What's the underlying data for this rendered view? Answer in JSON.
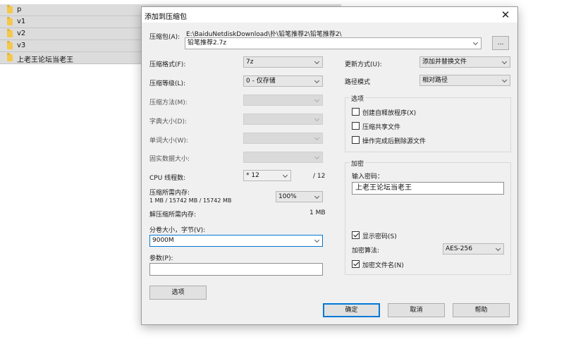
{
  "explorer": {
    "rows": [
      {
        "name": "p"
      },
      {
        "name": "v1"
      },
      {
        "name": "v2"
      },
      {
        "name": "v3"
      },
      {
        "name": "上老王论坛当老王"
      }
    ]
  },
  "dialog": {
    "title": "添加到压缩包",
    "close_glyph": "✕",
    "archive": {
      "label": "压缩包(A):",
      "path": "E:\\BaiduNetdiskDownload\\扑\\铅笔推荐2\\铅笔推荐2\\",
      "name_value": "铅笔推荐2.7z",
      "browse_label": "..."
    },
    "left": {
      "format": {
        "label": "压缩格式(F):",
        "value": "7z"
      },
      "level": {
        "label": "压缩等级(L):",
        "value": "0 - 仅存储"
      },
      "method": {
        "label": "压缩方法(M):",
        "value": ""
      },
      "dict": {
        "label": "字典大小(D):",
        "value": ""
      },
      "word": {
        "label": "单词大小(W):",
        "value": ""
      },
      "solid": {
        "label": "固实数据大小:",
        "value": ""
      },
      "cpu": {
        "label": "CPU 线程数:",
        "value": "* 12",
        "max": "/ 12"
      },
      "mem": {
        "label": "压缩所需内存:",
        "detail": "1 MB / 15742 MB / 15742 MB",
        "percent": "100%"
      },
      "decomp": {
        "label": "解压缩所需内存:",
        "value": "1 MB"
      },
      "split": {
        "label": "分卷大小，字节(V):",
        "value": "9000M"
      },
      "params": {
        "label": "参数(P):",
        "value": ""
      },
      "options_button": "选项"
    },
    "right": {
      "update": {
        "label": "更新方式(U):",
        "value": "添加并替换文件"
      },
      "pathmode": {
        "label": "路径模式",
        "value": "相对路径"
      },
      "options_group": {
        "title": "选项",
        "items": [
          {
            "label": "创建自释放程序(X)",
            "checked": false
          },
          {
            "label": "压缩共享文件",
            "checked": false
          },
          {
            "label": "操作完成后删除源文件",
            "checked": false
          }
        ]
      },
      "encrypt_group": {
        "title": "加密",
        "password_label": "输入密码：",
        "password_value": "上老王论坛当老王",
        "show_password": {
          "label": "显示密码(S)",
          "checked": true
        },
        "method": {
          "label": "加密算法:",
          "value": "AES-256"
        },
        "encrypt_names": {
          "label": "加密文件名(N)",
          "checked": true
        }
      }
    },
    "buttons": {
      "ok": "确定",
      "cancel": "取消",
      "help": "帮助"
    }
  }
}
